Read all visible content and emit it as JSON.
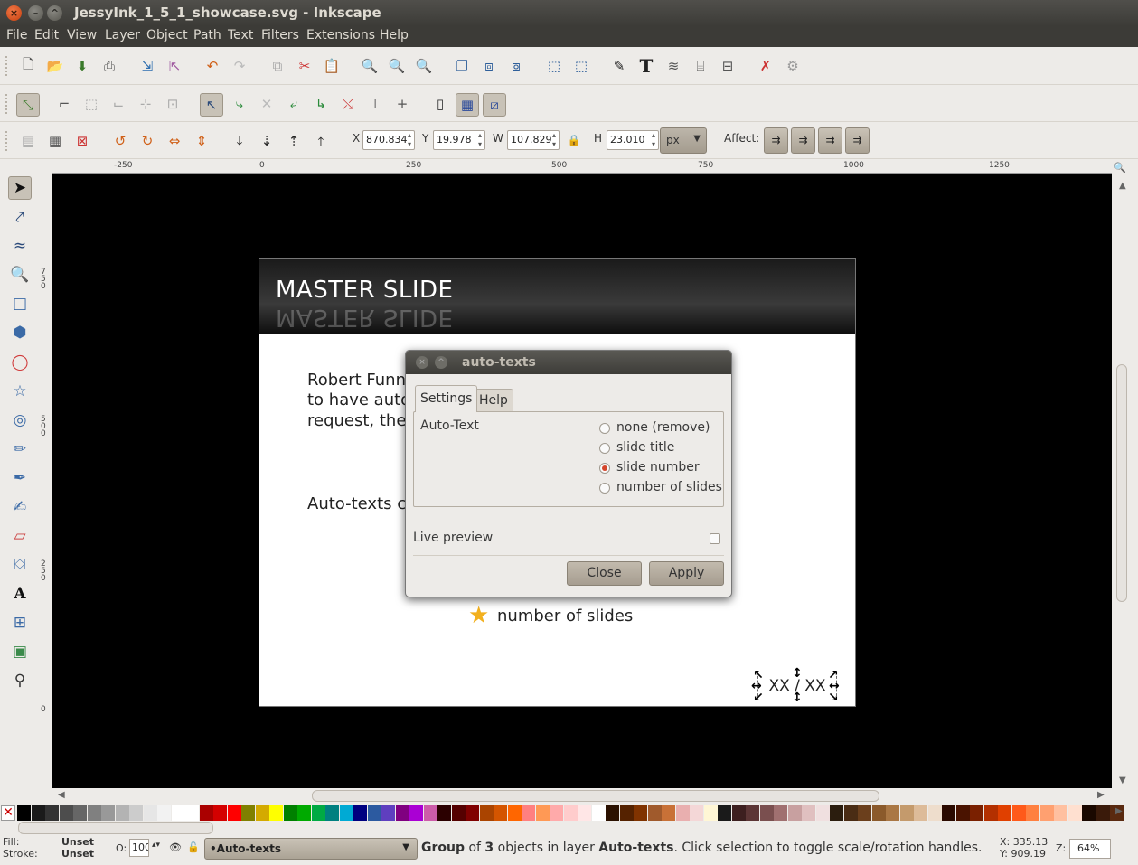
{
  "window": {
    "title": "JessyInk_1_5_1_showcase.svg - Inkscape"
  },
  "menu": [
    "File",
    "Edit",
    "View",
    "Layer",
    "Object",
    "Path",
    "Text",
    "Filters",
    "Extensions",
    "Help"
  ],
  "selection_toolbar": {
    "x_label": "X",
    "x_value": "870.834",
    "y_label": "Y",
    "y_value": "19.978",
    "w_label": "W",
    "w_value": "107.829",
    "h_label": "H",
    "h_value": "23.010",
    "unit": "px",
    "affect_label": "Affect:"
  },
  "ruler": {
    "h_ticks": [
      "-250",
      "0",
      "250",
      "500",
      "750",
      "1000",
      "1250"
    ],
    "v_ticks": [
      "750",
      "500",
      "250",
      "0"
    ]
  },
  "slide": {
    "title": "MASTER SLIDE",
    "line1": "Robert Funn",
    "line2": "to have auto",
    "line3": "request, the",
    "line4": "Auto-texts c",
    "star_label": "number of slides",
    "autotext": "XX / XX"
  },
  "dialog": {
    "title": "auto-texts",
    "tabs": {
      "settings": "Settings",
      "help": "Help"
    },
    "auto_text_label": "Auto-Text",
    "options": [
      "none (remove)",
      "slide title",
      "slide number",
      "number of slides"
    ],
    "selected_option": "slide number",
    "live_preview_label": "Live preview",
    "live_preview_checked": false,
    "close_label": "Close",
    "apply_label": "Apply"
  },
  "status": {
    "fill_label": "Fill:",
    "fill_value": "Unset",
    "stroke_label": "Stroke:",
    "stroke_value": "Unset",
    "opacity_label": "O:",
    "opacity_value": "100",
    "layer": "•Auto-texts",
    "msg_group": "Group",
    "msg_of": " of ",
    "msg_count": "3",
    "msg_objects": " objects in layer ",
    "msg_layer": "Auto-texts",
    "msg_tail": ". Click selection to toggle scale/rotation handles.",
    "x_coord": "X:  335.13",
    "y_coord": "Y:  909.19",
    "zoom_label": "Z:",
    "zoom_value": "64%"
  },
  "palette_colors": [
    "#000000",
    "#1a1a1a",
    "#333333",
    "#4d4d4d",
    "#666666",
    "#808080",
    "#999999",
    "#b3b3b3",
    "#cccccc",
    "#e6e6e6",
    "#f2f2f2",
    "#ffffff",
    "#ffffff",
    "#aa0000",
    "#d40000",
    "#ff0000",
    "#808000",
    "#d4aa00",
    "#ffff00",
    "#008000",
    "#00aa00",
    "#00aa44",
    "#008080",
    "#00aad4",
    "#000080",
    "#2c5aa0",
    "#5f3fbf",
    "#800080",
    "#aa00d4",
    "#cd5ca9",
    "#2b0000",
    "#550000",
    "#800000",
    "#aa4400",
    "#d45500",
    "#ff6600",
    "#ff8080",
    "#ff9955",
    "#ffaaaa",
    "#ffcccc",
    "#ffe6e6",
    "#ffffff",
    "#2b1100",
    "#552200",
    "#803300",
    "#a05a2c",
    "#c87137",
    "#e9afaf",
    "#f4d7d7",
    "#fff6d5",
    "#1a1a1a",
    "#3d1f1f",
    "#5c3535",
    "#7a4f4f",
    "#a07070",
    "#c8a0a0",
    "#e0c0c0",
    "#f0e0e0",
    "#2b1d0e",
    "#4a2c14",
    "#6b3f1c",
    "#8b5a2b",
    "#aa7744",
    "#c49a6c",
    "#ddbb99",
    "#eeddcc",
    "#2b0a00",
    "#4a1300",
    "#7a2000",
    "#b33000",
    "#e04000",
    "#ff5a1a",
    "#ff8040",
    "#ffa070",
    "#ffc0a0",
    "#ffe0d0",
    "#1a0800",
    "#3a1a0a",
    "#5a2a10",
    "#7a3a1a",
    "#9a4a2a",
    "#ba6a4a"
  ]
}
